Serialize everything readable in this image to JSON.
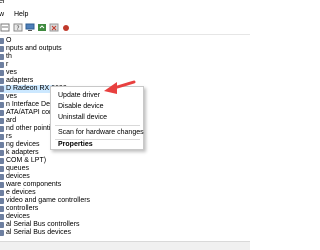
{
  "window": {
    "title_fragment": "er"
  },
  "menu": [
    "w",
    "Help"
  ],
  "tree_items": [
    "O",
    "nputs and outputs",
    "th",
    "r",
    "ves",
    "adapters",
    "D Radeon RX 6600",
    "ves",
    "n Interface Devices",
    "ATA/ATAPI controllers",
    "ard",
    "nd other pointing",
    "rs",
    "ng devices",
    "k adapters",
    "COM & LPT)",
    "queues",
    "devices",
    "ware components",
    "e devices",
    "video and game controllers",
    "controllers",
    "devices",
    "al Serial Bus controllers",
    "al Serial Bus devices"
  ],
  "context_menu": {
    "update_driver": "Update driver",
    "disable_device": "Disable device",
    "uninstall_device": "Uninstall device",
    "scan_hardware": "Scan for hardware changes",
    "properties": "Properties"
  },
  "colors": {
    "arrow": "#e8403f",
    "selection": "#cce8ff",
    "device_icon": "#6d7fa0"
  }
}
